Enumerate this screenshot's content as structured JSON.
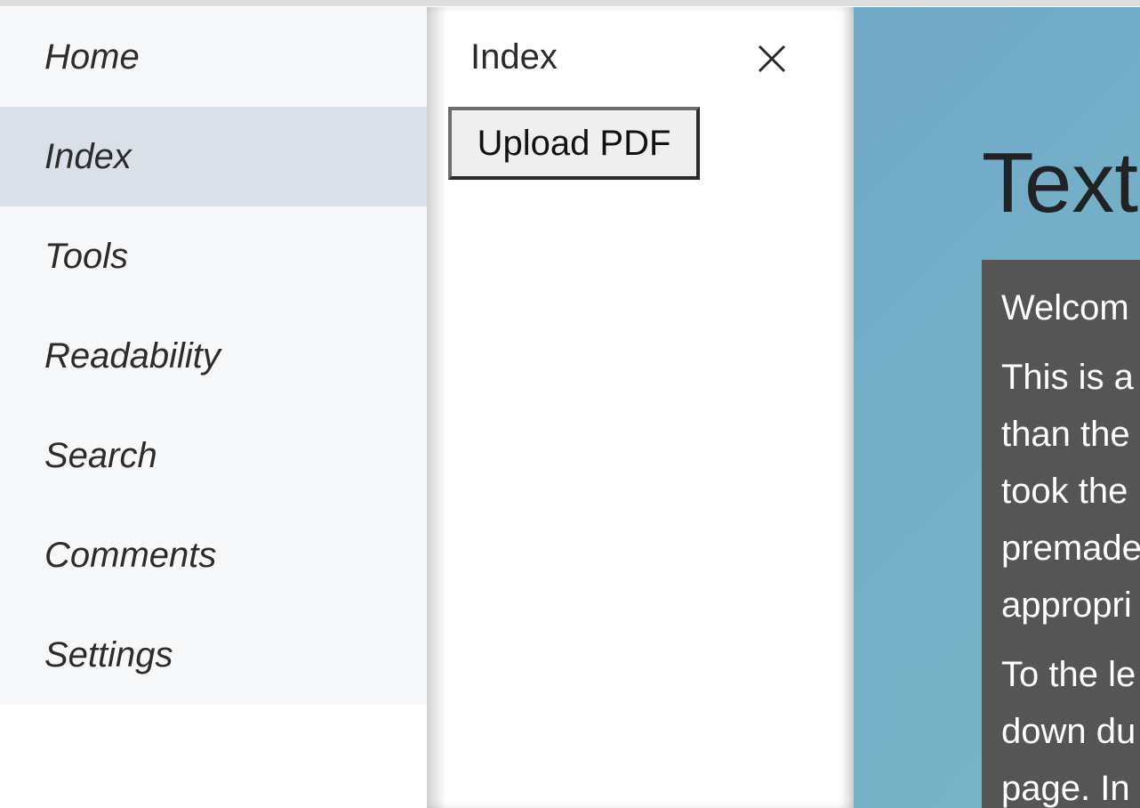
{
  "sidebar": {
    "items": [
      {
        "label": "Home"
      },
      {
        "label": "Index"
      },
      {
        "label": "Tools"
      },
      {
        "label": "Readability"
      },
      {
        "label": "Search"
      },
      {
        "label": "Comments"
      },
      {
        "label": "Settings"
      }
    ],
    "active_index": 1
  },
  "panel": {
    "title": "Index",
    "close_icon": "close-icon",
    "upload_label": "Upload PDF"
  },
  "main": {
    "heading": "Text",
    "card": {
      "p1": "Welcom",
      "p2": [
        "This is a",
        "than the",
        "took the",
        "premade",
        "appropri"
      ],
      "p3": [
        "To the le",
        "down du",
        "page. In"
      ]
    }
  },
  "colors": {
    "sidebar_bg": "#f7f8fa",
    "sidebar_active": "#dae0e8",
    "content_bg": "#75afc7",
    "card_bg": "#555555"
  }
}
